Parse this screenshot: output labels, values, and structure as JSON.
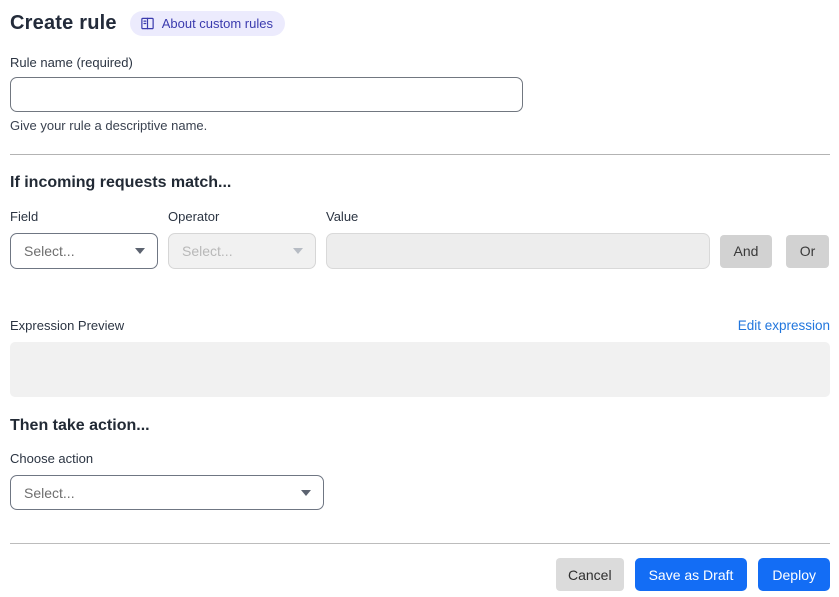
{
  "page": {
    "title": "Create rule",
    "about_link": "About custom rules"
  },
  "rule_name": {
    "label": "Rule name (required)",
    "value": "",
    "helper": "Give your rule a descriptive name."
  },
  "match_section": {
    "heading": "If incoming requests match...",
    "field_label": "Field",
    "operator_label": "Operator",
    "value_label": "Value",
    "field_placeholder": "Select...",
    "operator_placeholder": "Select...",
    "value_value": "",
    "and_button": "And",
    "or_button": "Or",
    "expression_preview_label": "Expression Preview",
    "edit_expression_link": "Edit expression",
    "expression_value": ""
  },
  "action_section": {
    "heading": "Then take action...",
    "choose_action_label": "Choose action",
    "action_placeholder": "Select..."
  },
  "footer": {
    "cancel": "Cancel",
    "save_draft": "Save as Draft",
    "deploy": "Deploy"
  },
  "colors": {
    "primary_blue": "#136df5",
    "link_blue": "#2176dd",
    "badge_bg": "#ecebfd",
    "badge_text": "#3b3bae"
  }
}
